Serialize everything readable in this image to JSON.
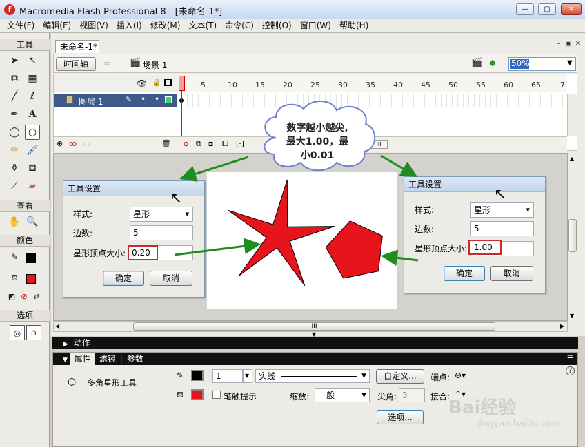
{
  "window": {
    "title": "Macromedia Flash Professional 8 - [未命名-1*]",
    "app_icon_glyph": "f",
    "minimize_glyph": "—",
    "maximize_glyph": "▢",
    "close_glyph": "✕"
  },
  "menu": [
    "文件(F)",
    "编辑(E)",
    "视图(V)",
    "插入(I)",
    "修改(M)",
    "文本(T)",
    "命令(C)",
    "控制(O)",
    "窗口(W)",
    "帮助(H)"
  ],
  "toolbox": {
    "header_tools": "工具",
    "header_view": "查看",
    "header_colors": "颜色",
    "header_options": "选项"
  },
  "document": {
    "tab_name": "未命名-1*",
    "timeline_button": "时间轴",
    "scene": "场景 1",
    "zoom": "50%"
  },
  "timeline": {
    "frame_numbers": [
      "1",
      "5",
      "10",
      "15",
      "20",
      "25",
      "30",
      "35",
      "40",
      "45",
      "50",
      "55",
      "60",
      "65",
      "7"
    ],
    "layer_name": "图层 1"
  },
  "callout": {
    "lines": [
      "数字越小越尖,",
      "最大1.00，最",
      "小0.01"
    ]
  },
  "dialog_left": {
    "title": "工具设置",
    "style_label": "样式:",
    "style_value": "星形",
    "sides_label": "边数:",
    "sides_value": "5",
    "point_label": "星形顶点大小:",
    "point_value": "0.20",
    "ok": "确定",
    "cancel": "取消"
  },
  "dialog_right": {
    "title": "工具设置",
    "style_label": "样式:",
    "style_value": "星形",
    "sides_label": "边数:",
    "sides_value": "5",
    "point_label": "星形顶点大小:",
    "point_value": "1.00",
    "ok": "确定",
    "cancel": "取消"
  },
  "shapes": {
    "fill_color": "#e8141c",
    "stroke_color": "#000000"
  },
  "actions_panel": {
    "label": "动作"
  },
  "properties": {
    "tabs": [
      "属性",
      "滤镜",
      "参数"
    ],
    "tool_name": "多角星形工具",
    "stroke_width": "1",
    "stroke_style": "实线",
    "custom_button": "自定义...",
    "cap_label": "端点:",
    "stroke_hint_label": "笔触提示",
    "scale_label": "缩放:",
    "scale_value": "一般",
    "miter_label": "尖角:",
    "miter_value": "3",
    "join_label": "接合:",
    "options_button": "选项...",
    "help_glyph": "?"
  },
  "watermark": {
    "brand": "Bai经验",
    "url": "jingyan.baidu.com"
  }
}
